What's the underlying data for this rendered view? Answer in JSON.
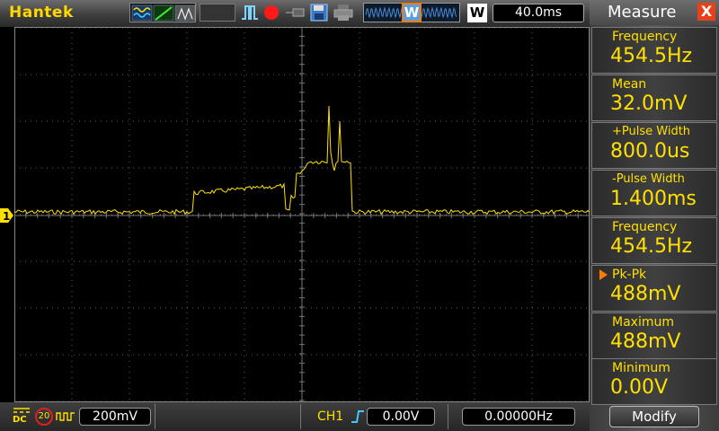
{
  "top_bar": {
    "brand": "Hantek",
    "timebase": "40.0ms",
    "zoom_mark": "W",
    "window_mark": "W"
  },
  "channel": {
    "marker_label": "1",
    "color": "#ffe000"
  },
  "measure": {
    "title": "Measure",
    "close_label": "X",
    "items": [
      {
        "label": "Frequency",
        "value": "454.5Hz"
      },
      {
        "label": "Mean",
        "value": "32.0mV"
      },
      {
        "label": "+Pulse Width",
        "value": "800.0us"
      },
      {
        "label": "-Pulse Width",
        "value": "1.400ms"
      },
      {
        "label": "Frequency",
        "value": "454.5Hz"
      },
      {
        "label": "Pk-Pk",
        "value": "488mV"
      },
      {
        "label": "Maximum",
        "value": "488mV"
      },
      {
        "label": "Minimum",
        "value": "0.00V"
      }
    ],
    "selected_index": 5,
    "modify_label": "Modify"
  },
  "bottom_bar": {
    "coupling": "DC",
    "bandwidth_limit": "20",
    "volts_per_div": "200mV",
    "trigger_source": "CH1",
    "trigger_level": "0.00V",
    "trigger_frequency": "0.00000Hz"
  },
  "icons": [
    "waveform-mode-icon",
    "ramp-icon",
    "envelope-icon",
    "trigger-pulse-icon",
    "record-dot-icon",
    "probe-icon",
    "save-icon",
    "print-icon",
    "close-icon",
    "rising-edge-icon",
    "bandwidth-wave-icon"
  ]
}
